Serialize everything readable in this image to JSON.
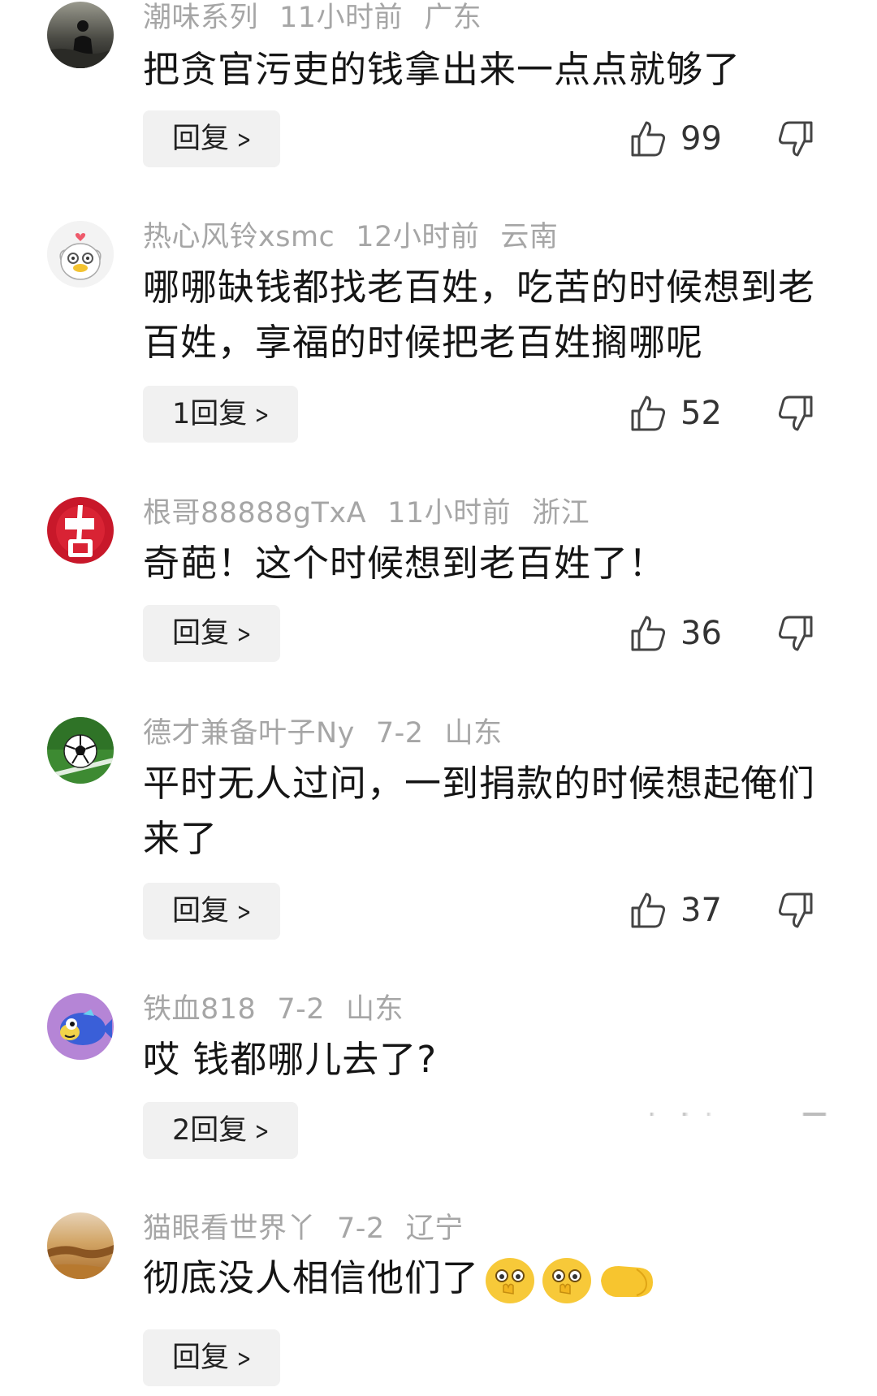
{
  "comments": [
    {
      "avatar": "silhouette-avatar",
      "username": "潮味系列",
      "time": "11小时前",
      "location": "广东",
      "text": "把贪官污吏的钱拿出来一点点就够了",
      "reply_label": "回复",
      "likes": "99"
    },
    {
      "avatar": "cartoon-duck-avatar",
      "username": "热心风铃xsmc",
      "time": "12小时前",
      "location": "云南",
      "text": "哪哪缺钱都找老百姓，吃苦的时候想到老百姓，享福的时候把老百姓搁哪呢",
      "reply_label": "1回复",
      "likes": "52"
    },
    {
      "avatar": "red-zhongguo-avatar",
      "username": "根哥88888gTxA",
      "time": "11小时前",
      "location": "浙江",
      "text": "奇葩！这个时候想到老百姓了！",
      "reply_label": "回复",
      "likes": "36"
    },
    {
      "avatar": "soccer-ball-avatar",
      "username": "德才兼备叶子Ny",
      "time": "7-2",
      "location": "山东",
      "text": "平时无人过问，一到捐款的时候想起俺们来了",
      "reply_label": "回复",
      "likes": "37"
    },
    {
      "avatar": "cartoon-fish-avatar",
      "username": "铁血818",
      "time": "7-2",
      "location": "山东",
      "text": "哎 钱都哪儿去了?",
      "reply_label": "2回复",
      "likes": ""
    },
    {
      "avatar": "great-wall-avatar",
      "username": "猫眼看世界丫",
      "time": "7-2",
      "location": "辽宁",
      "text": "彻底没人相信他们了",
      "emojis": [
        "shy-face-emoji",
        "shy-face-emoji",
        "fist-bump-emoji"
      ],
      "reply_label": "回复",
      "likes": ""
    }
  ],
  "colors": {
    "meta": "#a6a6a6",
    "text": "#151515",
    "reply_bg": "#f1f1f1"
  }
}
